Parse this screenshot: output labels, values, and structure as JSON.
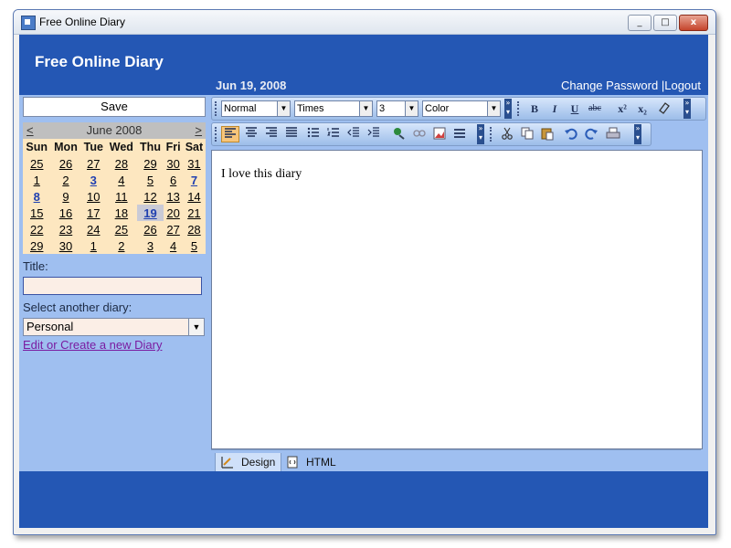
{
  "window": {
    "title": "Free Online Diary",
    "minimize_label": "_",
    "maximize_label": "□",
    "close_label": "x"
  },
  "header": {
    "title": "Free Online Diary",
    "date": "Jun 19, 2008",
    "change_password": "Change Password",
    "separator": "|",
    "logout": "Logout"
  },
  "sidebar": {
    "save_label": "Save",
    "calendar": {
      "prev": "<",
      "next": ">",
      "month": "June 2008",
      "days": [
        "Sun",
        "Mon",
        "Tue",
        "Wed",
        "Thu",
        "Fri",
        "Sat"
      ],
      "weeks": [
        [
          "25",
          "26",
          "27",
          "28",
          "29",
          "30",
          "31"
        ],
        [
          "1",
          "2",
          "3",
          "4",
          "5",
          "6",
          "7"
        ],
        [
          "8",
          "9",
          "10",
          "11",
          "12",
          "13",
          "14"
        ],
        [
          "15",
          "16",
          "17",
          "18",
          "19",
          "20",
          "21"
        ],
        [
          "22",
          "23",
          "24",
          "25",
          "26",
          "27",
          "28"
        ],
        [
          "29",
          "30",
          "1",
          "2",
          "3",
          "4",
          "5"
        ]
      ]
    },
    "title_label": "Title:",
    "title_value": "",
    "select_label": "Select another diary:",
    "selected_diary": "Personal",
    "edit_link": "Edit or Create a new Diary"
  },
  "toolbar": {
    "format": "Normal",
    "font": "Times",
    "size": "3",
    "color": "Color",
    "bold": "B",
    "italic": "I",
    "underline": "U",
    "strike": "abc",
    "superscript": "x²",
    "subscript": "x₂"
  },
  "editor": {
    "content": "I love this diary"
  },
  "tabs": {
    "design": "Design",
    "html": "HTML"
  }
}
